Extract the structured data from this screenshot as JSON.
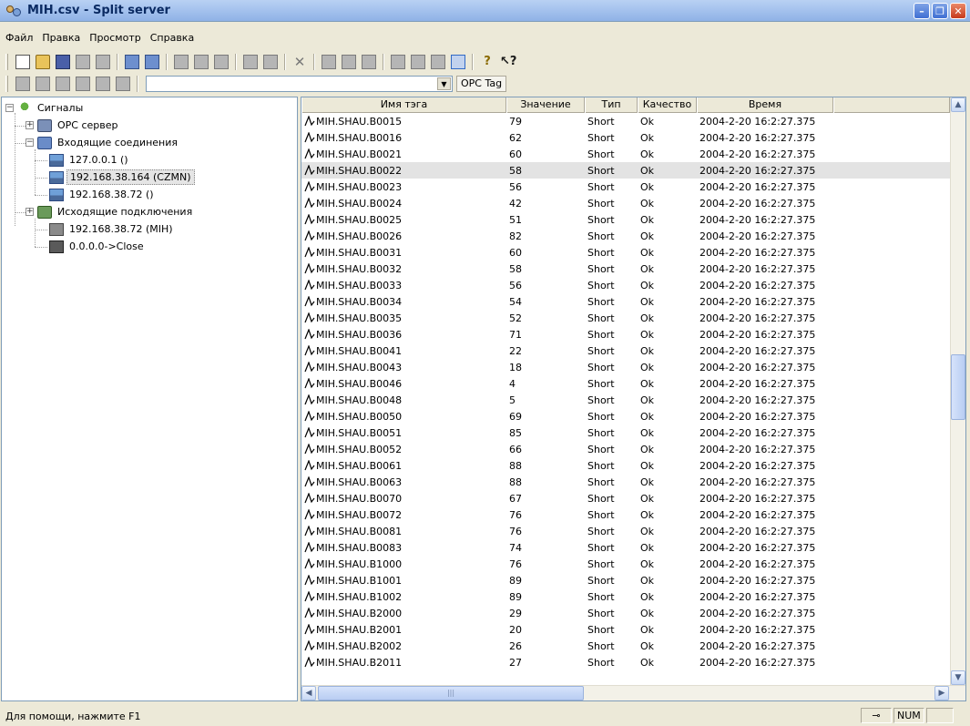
{
  "window": {
    "title": "MIH.csv - Split server"
  },
  "menu": [
    "Файл",
    "Правка",
    "Просмотр",
    "Справка"
  ],
  "toolbar": {
    "combo_value": "",
    "opc_button_label": "OPC Tag"
  },
  "tree": {
    "root": "Сигналы",
    "opc_server": "OPC сервер",
    "incoming": "Входящие соединения",
    "incoming_items": [
      "127.0.0.1 ()",
      "192.168.38.164 (CZMN)",
      "192.168.38.72 ()"
    ],
    "outgoing": "Исходящие подключения",
    "outgoing_item": "192.168.38.72 (MIH)",
    "close_item": "0.0.0.0->Close"
  },
  "table": {
    "headers": [
      "Имя тэга",
      "Значение",
      "Тип",
      "Качество",
      "Время"
    ],
    "rows": [
      [
        "MIH.SHAU.B0015",
        "79",
        "Short",
        "Ok",
        "2004-2-20  16:2:27.375"
      ],
      [
        "MIH.SHAU.B0016",
        "62",
        "Short",
        "Ok",
        "2004-2-20  16:2:27.375"
      ],
      [
        "MIH.SHAU.B0021",
        "60",
        "Short",
        "Ok",
        "2004-2-20  16:2:27.375"
      ],
      [
        "MIH.SHAU.B0022",
        "58",
        "Short",
        "Ok",
        "2004-2-20  16:2:27.375"
      ],
      [
        "MIH.SHAU.B0023",
        "56",
        "Short",
        "Ok",
        "2004-2-20  16:2:27.375"
      ],
      [
        "MIH.SHAU.B0024",
        "42",
        "Short",
        "Ok",
        "2004-2-20  16:2:27.375"
      ],
      [
        "MIH.SHAU.B0025",
        "51",
        "Short",
        "Ok",
        "2004-2-20  16:2:27.375"
      ],
      [
        "MIH.SHAU.B0026",
        "82",
        "Short",
        "Ok",
        "2004-2-20  16:2:27.375"
      ],
      [
        "MIH.SHAU.B0031",
        "60",
        "Short",
        "Ok",
        "2004-2-20  16:2:27.375"
      ],
      [
        "MIH.SHAU.B0032",
        "58",
        "Short",
        "Ok",
        "2004-2-20  16:2:27.375"
      ],
      [
        "MIH.SHAU.B0033",
        "56",
        "Short",
        "Ok",
        "2004-2-20  16:2:27.375"
      ],
      [
        "MIH.SHAU.B0034",
        "54",
        "Short",
        "Ok",
        "2004-2-20  16:2:27.375"
      ],
      [
        "MIH.SHAU.B0035",
        "52",
        "Short",
        "Ok",
        "2004-2-20  16:2:27.375"
      ],
      [
        "MIH.SHAU.B0036",
        "71",
        "Short",
        "Ok",
        "2004-2-20  16:2:27.375"
      ],
      [
        "MIH.SHAU.B0041",
        "22",
        "Short",
        "Ok",
        "2004-2-20  16:2:27.375"
      ],
      [
        "MIH.SHAU.B0043",
        "18",
        "Short",
        "Ok",
        "2004-2-20  16:2:27.375"
      ],
      [
        "MIH.SHAU.B0046",
        "4",
        "Short",
        "Ok",
        "2004-2-20  16:2:27.375"
      ],
      [
        "MIH.SHAU.B0048",
        "5",
        "Short",
        "Ok",
        "2004-2-20  16:2:27.375"
      ],
      [
        "MIH.SHAU.B0050",
        "69",
        "Short",
        "Ok",
        "2004-2-20  16:2:27.375"
      ],
      [
        "MIH.SHAU.B0051",
        "85",
        "Short",
        "Ok",
        "2004-2-20  16:2:27.375"
      ],
      [
        "MIH.SHAU.B0052",
        "66",
        "Short",
        "Ok",
        "2004-2-20  16:2:27.375"
      ],
      [
        "MIH.SHAU.B0061",
        "88",
        "Short",
        "Ok",
        "2004-2-20  16:2:27.375"
      ],
      [
        "MIH.SHAU.B0063",
        "88",
        "Short",
        "Ok",
        "2004-2-20  16:2:27.375"
      ],
      [
        "MIH.SHAU.B0070",
        "67",
        "Short",
        "Ok",
        "2004-2-20  16:2:27.375"
      ],
      [
        "MIH.SHAU.B0072",
        "76",
        "Short",
        "Ok",
        "2004-2-20  16:2:27.375"
      ],
      [
        "MIH.SHAU.B0081",
        "76",
        "Short",
        "Ok",
        "2004-2-20  16:2:27.375"
      ],
      [
        "MIH.SHAU.B0083",
        "74",
        "Short",
        "Ok",
        "2004-2-20  16:2:27.375"
      ],
      [
        "MIH.SHAU.B1000",
        "76",
        "Short",
        "Ok",
        "2004-2-20  16:2:27.375"
      ],
      [
        "MIH.SHAU.B1001",
        "89",
        "Short",
        "Ok",
        "2004-2-20  16:2:27.375"
      ],
      [
        "MIH.SHAU.B1002",
        "89",
        "Short",
        "Ok",
        "2004-2-20  16:2:27.375"
      ],
      [
        "MIH.SHAU.B2000",
        "29",
        "Short",
        "Ok",
        "2004-2-20  16:2:27.375"
      ],
      [
        "MIH.SHAU.B2001",
        "20",
        "Short",
        "Ok",
        "2004-2-20  16:2:27.375"
      ],
      [
        "MIH.SHAU.B2002",
        "26",
        "Short",
        "Ok",
        "2004-2-20  16:2:27.375"
      ],
      [
        "MIH.SHAU.B2011",
        "27",
        "Short",
        "Ok",
        "2004-2-20  16:2:27.375"
      ]
    ],
    "highlighted_row": 3
  },
  "status": {
    "help_text": "Для помощи, нажмите F1",
    "num": "NUM"
  },
  "colors": {
    "title_text": "#0b2b63",
    "highlight_row": "#e3e3e3",
    "frame": "#7f9db9"
  }
}
